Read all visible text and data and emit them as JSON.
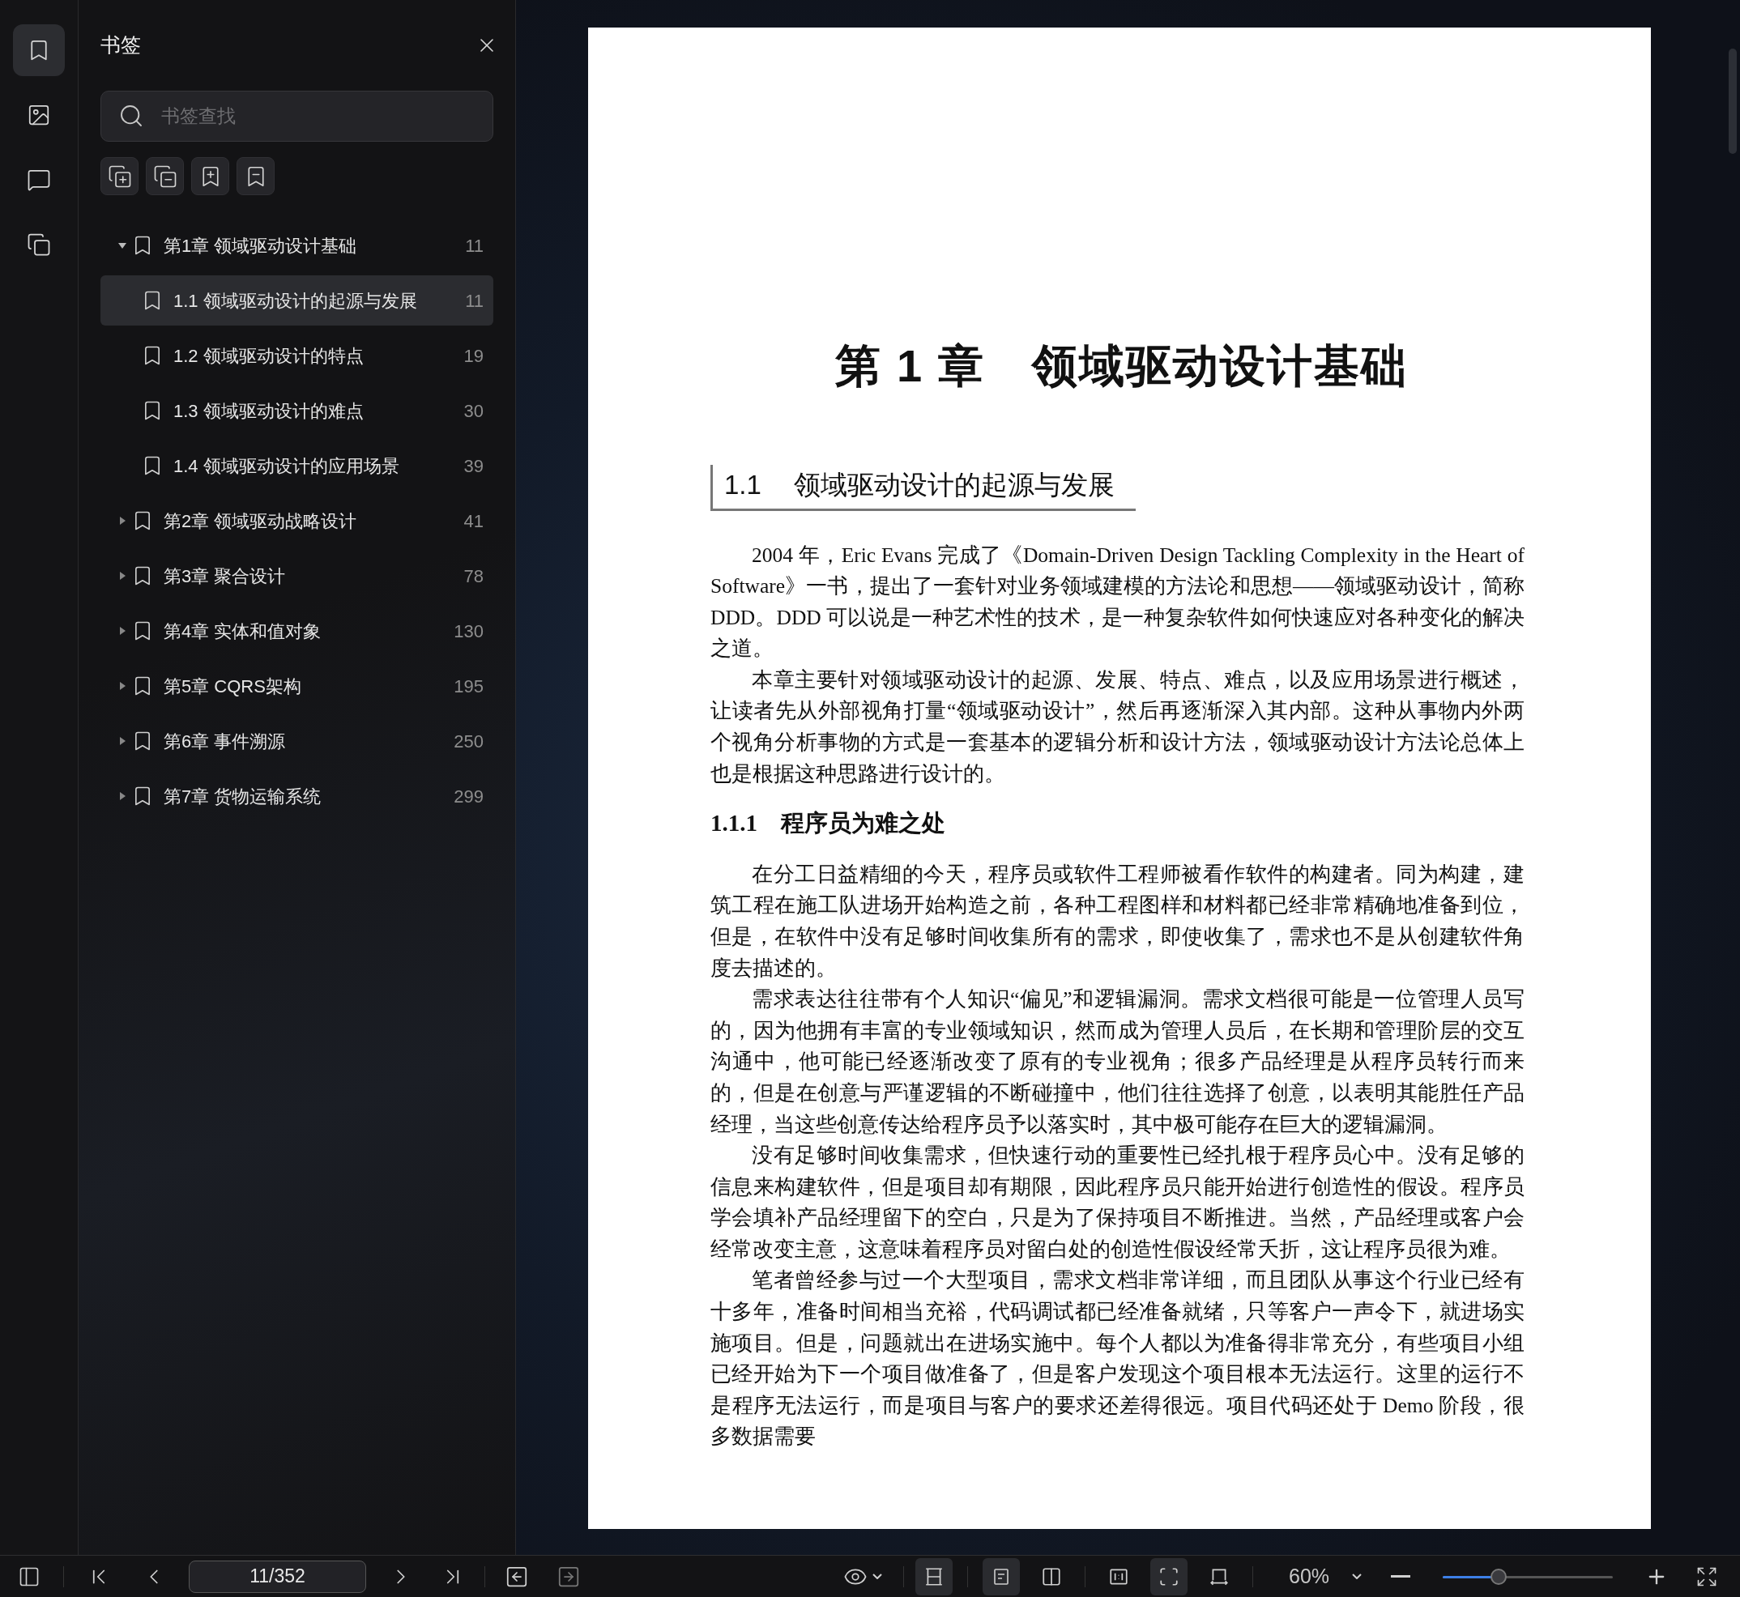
{
  "rail": [
    {
      "kind": "bookmarks",
      "selected": true
    },
    {
      "kind": "images",
      "selected": false
    },
    {
      "kind": "comments",
      "selected": false
    },
    {
      "kind": "pages",
      "selected": false
    }
  ],
  "sidebar": {
    "title": "书签",
    "search": {
      "placeholder": "书签查找"
    },
    "bookmarks": [
      {
        "label": "第1章 领域驱动设计基础",
        "page": "11",
        "expanded": true,
        "selected": false,
        "children": [
          {
            "label": "1.1 领域驱动设计的起源与发展",
            "page": "11",
            "selected": true
          },
          {
            "label": "1.2 领域驱动设计的特点",
            "page": "19",
            "selected": false
          },
          {
            "label": "1.3 领域驱动设计的难点",
            "page": "30",
            "selected": false
          },
          {
            "label": "1.4 领域驱动设计的应用场景",
            "page": "39",
            "selected": false
          }
        ]
      },
      {
        "label": "第2章 领域驱动战略设计",
        "page": "41",
        "expanded": false,
        "selected": false
      },
      {
        "label": "第3章 聚合设计",
        "page": "78",
        "expanded": false,
        "selected": false
      },
      {
        "label": "第4章 实体和值对象",
        "page": "130",
        "expanded": false,
        "selected": false
      },
      {
        "label": "第5章 CQRS架构",
        "page": "195",
        "expanded": false,
        "selected": false
      },
      {
        "label": "第6章 事件溯源",
        "page": "250",
        "expanded": false,
        "selected": false
      },
      {
        "label": "第7章 货物运输系统",
        "page": "299",
        "expanded": false,
        "selected": false
      }
    ]
  },
  "document": {
    "chapter_title": "第 1 章　领域驱动设计基础",
    "section_title": {
      "number": "1.1",
      "text": "领域驱动设计的起源与发展"
    },
    "blocks": [
      {
        "kind": "paragraph",
        "text": "2004 年，Eric Evans 完成了《Domain-Driven Design Tackling Complexity in the Heart of Software》一书，提出了一套针对业务领域建模的方法论和思想——领域驱动设计，简称 DDD。DDD 可以说是一种艺术性的技术，是一种复杂软件如何快速应对各种变化的解决之道。"
      },
      {
        "kind": "paragraph",
        "text": "本章主要针对领域驱动设计的起源、发展、特点、难点，以及应用场景进行概述，让读者先从外部视角打量“领域驱动设计”，然后再逐渐深入其内部。这种从事物内外两个视角分析事物的方式是一套基本的逻辑分析和设计方法，领域驱动设计方法论总体上也是根据这种思路进行设计的。"
      },
      {
        "kind": "heading",
        "text": "1.1.1　程序员为难之处"
      },
      {
        "kind": "paragraph",
        "text": "在分工日益精细的今天，程序员或软件工程师被看作软件的构建者。同为构建，建筑工程在施工队进场开始构造之前，各种工程图样和材料都已经非常精确地准备到位，但是，在软件中没有足够时间收集所有的需求，即使收集了，需求也不是从创建软件角度去描述的。"
      },
      {
        "kind": "paragraph",
        "text": "需求表达往往带有个人知识“偏见”和逻辑漏洞。需求文档很可能是一位管理人员写的，因为他拥有丰富的专业领域知识，然而成为管理人员后，在长期和管理阶层的交互沟通中，他可能已经逐渐改变了原有的专业视角；很多产品经理是从程序员转行而来的，但是在创意与严谨逻辑的不断碰撞中，他们往往选择了创意，以表明其能胜任产品经理，当这些创意传达给程序员予以落实时，其中极可能存在巨大的逻辑漏洞。"
      },
      {
        "kind": "paragraph",
        "text": "没有足够时间收集需求，但快速行动的重要性已经扎根于程序员心中。没有足够的信息来构建软件，但是项目却有期限，因此程序员只能开始进行创造性的假设。程序员学会填补产品经理留下的空白，只是为了保持项目不断推进。当然，产品经理或客户会经常改变主意，这意味着程序员对留白处的创造性假设经常夭折，这让程序员很为难。"
      },
      {
        "kind": "paragraph",
        "text": "笔者曾经参与过一个大型项目，需求文档非常详细，而且团队从事这个行业已经有十多年，准备时间相当充裕，代码调试都已经准备就绪，只等客户一声令下，就进场实施项目。但是，问题就出在进场实施中。每个人都以为准备得非常充分，有些项目小组已经开始为下一个项目做准备了，但是客户发现这个项目根本无法运行。这里的运行不是程序无法运行，而是项目与客户的要求还差得很远。项目代码还处于 Demo 阶段，很多数据需要"
      }
    ]
  },
  "toolbar": {
    "page_field": "11/352",
    "view_buttons": [
      {
        "kind": "continuous",
        "selected": true
      },
      {
        "kind": "single",
        "selected": true
      },
      {
        "kind": "double",
        "selected": false
      },
      {
        "kind": "actual",
        "selected": false
      },
      {
        "kind": "fit_page",
        "selected": true
      },
      {
        "kind": "fit_width",
        "selected": false
      }
    ],
    "zoom": "60%",
    "zoom_slider": {
      "level": 0.33
    }
  }
}
